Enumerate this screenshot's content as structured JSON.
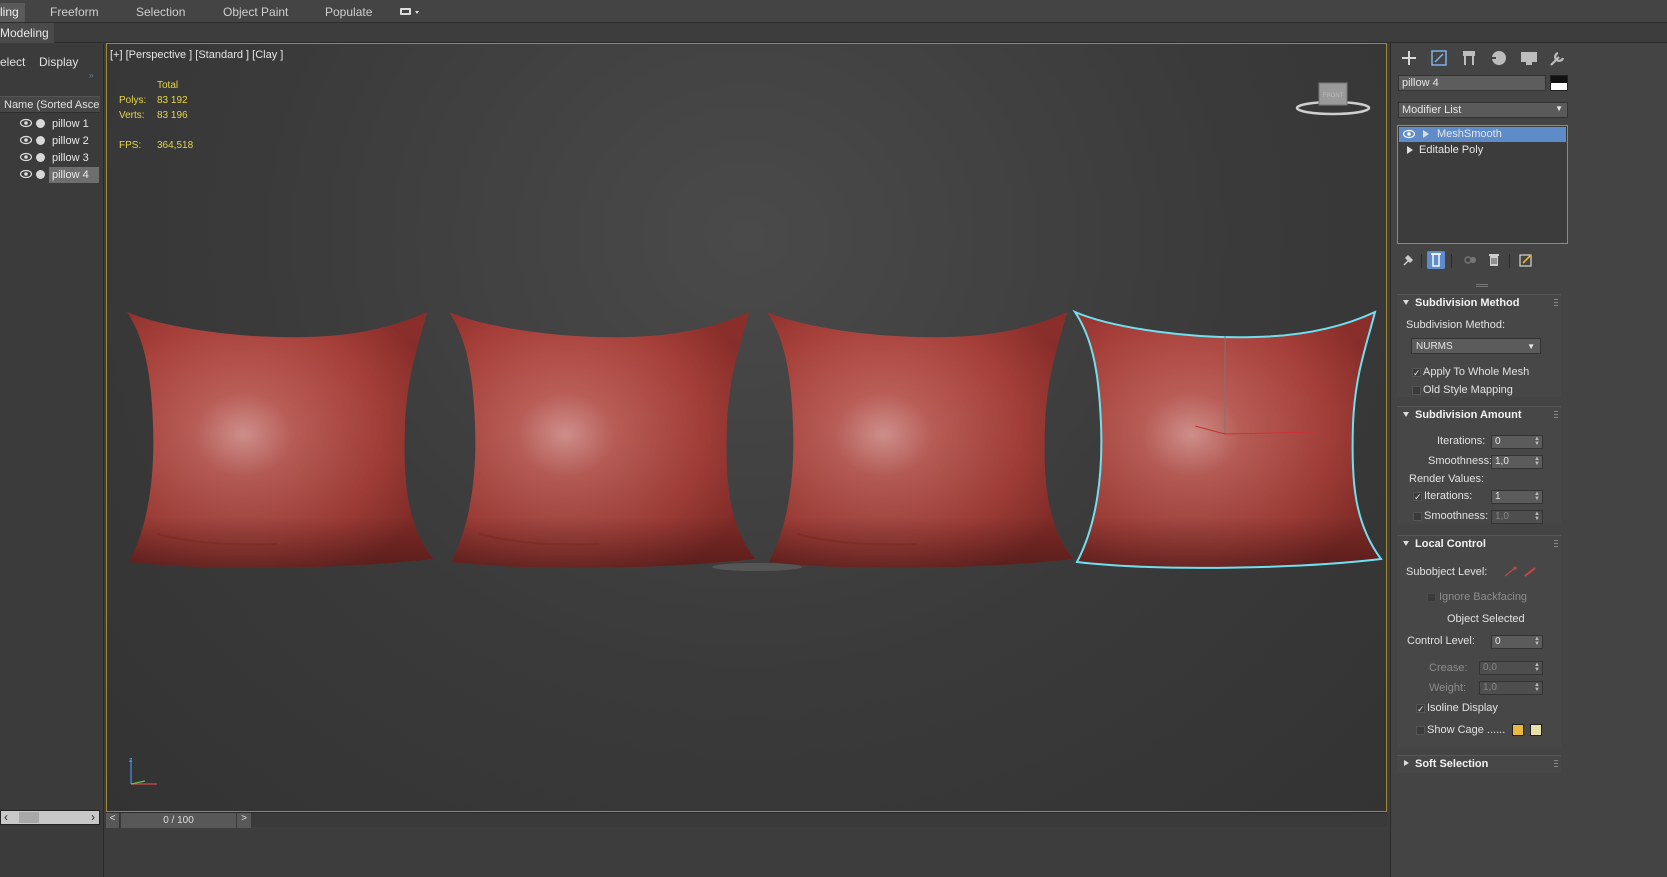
{
  "ribbon": {
    "tabs": [
      "ling",
      "Freeform",
      "Selection",
      "Object Paint",
      "Populate"
    ],
    "active_tab": "ling",
    "subtitle": "Modeling"
  },
  "explorer": {
    "tabs": [
      "elect",
      "Display"
    ],
    "column_header": "Name (Sorted Ascending)",
    "items": [
      {
        "label": "pillow 1",
        "selected": false
      },
      {
        "label": "pillow 2",
        "selected": false
      },
      {
        "label": "pillow 3",
        "selected": false
      },
      {
        "label": "pillow 4",
        "selected": true
      }
    ]
  },
  "viewport": {
    "label": "[+] [Perspective ] [Standard ] [Clay ]",
    "stats": {
      "total_label": "Total",
      "polys_label": "Polys:",
      "polys_value": "83 192",
      "verts_label": "Verts:",
      "verts_value": "83 196",
      "fps_label": "FPS:",
      "fps_value": "364,518"
    },
    "viewcube_label": "FRONT",
    "selection_color": "#6fe0f0",
    "pillow_color": "#b5463f"
  },
  "timeline": {
    "position_label": "0 / 100",
    "prev": "<",
    "next": ">"
  },
  "command_panel": {
    "object_name": "pillow 4",
    "modifier_list_label": "Modifier List",
    "stack": [
      {
        "label": "MeshSmooth",
        "selected": true
      },
      {
        "label": "Editable Poly",
        "selected": false
      }
    ],
    "subdivision_method": {
      "title": "Subdivision Method",
      "method_label": "Subdivision Method:",
      "method_value": "NURMS",
      "apply_whole_mesh": "Apply To Whole Mesh",
      "old_style_mapping": "Old Style Mapping"
    },
    "subdivision_amount": {
      "title": "Subdivision Amount",
      "iterations_label": "Iterations:",
      "iterations_value": "0",
      "smoothness_label": "Smoothness:",
      "smoothness_value": "1,0",
      "render_values_label": "Render Values:",
      "render_iterations_label": "Iterations:",
      "render_iterations_value": "1",
      "render_smoothness_label": "Smoothness:",
      "render_smoothness_value": "1,0"
    },
    "local_control": {
      "title": "Local Control",
      "subobject_label": "Subobject Level:",
      "ignore_backfacing": "Ignore Backfacing",
      "object_selected": "Object Selected",
      "control_level_label": "Control Level:",
      "control_level_value": "0",
      "crease_label": "Crease:",
      "crease_value": "0,0",
      "weight_label": "Weight:",
      "weight_value": "1,0",
      "isoline_display": "Isoline Display",
      "show_cage": "Show Cage ......",
      "cage_color_1": "#e8b93a",
      "cage_color_2": "#e8e0a8"
    },
    "soft_selection": {
      "title": "Soft Selection"
    }
  }
}
